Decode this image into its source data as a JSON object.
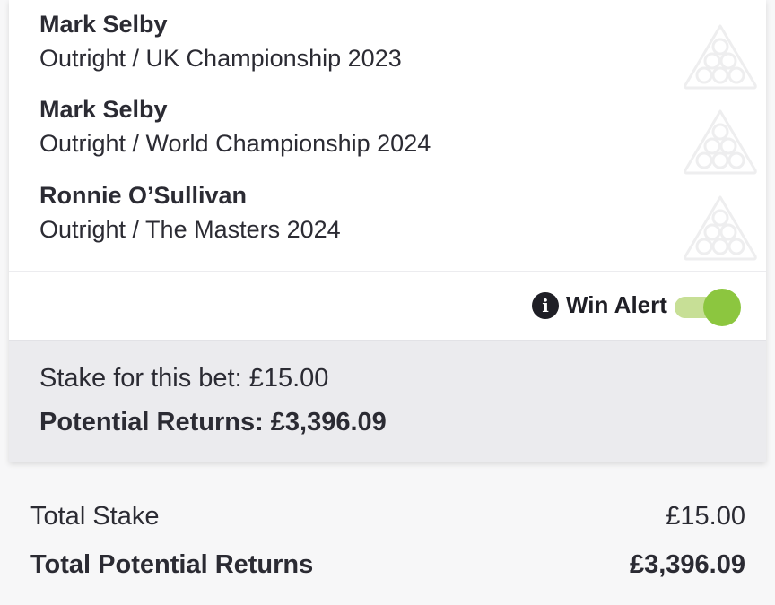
{
  "selections": [
    {
      "name": "Mark Selby",
      "market": "Outright / UK Championship 2023",
      "icon": "snooker-balls-icon"
    },
    {
      "name": "Mark Selby",
      "market": "Outright / World Championship 2024",
      "icon": "snooker-balls-icon"
    },
    {
      "name": "Ronnie O’Sullivan",
      "market": "Outright / The Masters 2024",
      "icon": "snooker-balls-icon"
    }
  ],
  "win_alert": {
    "info_icon": "i",
    "label": "Win Alert",
    "enabled": true
  },
  "bet_summary": {
    "stake_text": "Stake for this bet: £15.00",
    "returns_text": "Potential Returns: £3,396.09"
  },
  "totals": {
    "stake_label": "Total Stake",
    "stake_value": "£15.00",
    "returns_label": "Total Potential Returns",
    "returns_value": "£3,396.09"
  },
  "colors": {
    "toggle_on": "#8cc63f",
    "toggle_track": "#c7df96",
    "text": "#2b2b33",
    "stake_bg": "#ebebee",
    "page_bg": "#f7f7f8"
  }
}
